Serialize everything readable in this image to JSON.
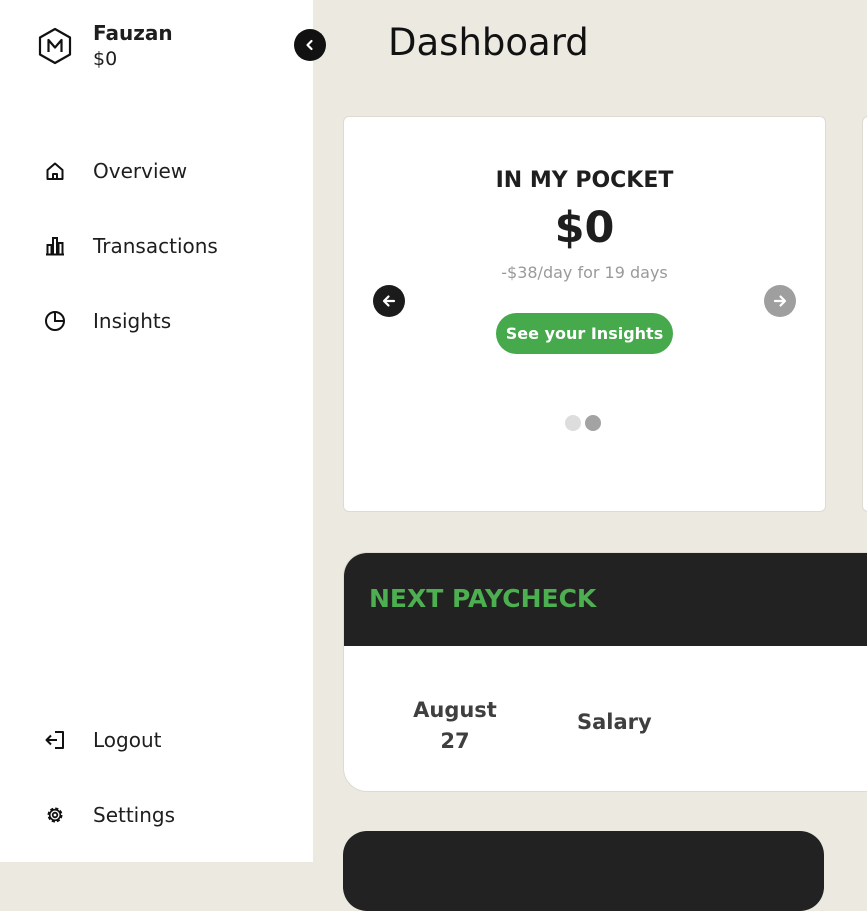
{
  "sidebar": {
    "logo_icon": "hexagon-m-logo-icon",
    "profile": {
      "name": "Fauzan",
      "balance": "$0"
    },
    "collapse_icon": "chevron-left-icon",
    "nav": [
      {
        "label": "Overview",
        "icon": "home-icon"
      },
      {
        "label": "Transactions",
        "icon": "bar-chart-icon"
      },
      {
        "label": "Insights",
        "icon": "pie-chart-icon"
      }
    ],
    "footer": [
      {
        "label": "Logout",
        "icon": "logout-icon"
      },
      {
        "label": "Settings",
        "icon": "gear-icon"
      }
    ]
  },
  "header": {
    "title": "Dashboard"
  },
  "pocket_card": {
    "title": "IN MY POCKET",
    "amount": "$0",
    "subtitle": "-$38/day for 19 days",
    "button_label": "See your Insights",
    "prev_icon": "arrow-left-icon",
    "next_icon": "arrow-right-icon",
    "slide_count": 2,
    "active_slide": 2
  },
  "paycheck_card": {
    "title": "NEXT PAYCHECK",
    "date": "August 27",
    "description": "Salary"
  },
  "colors": {
    "accent_green": "#46a94b",
    "paycheck_title_green": "#4caf50",
    "dark": "#222222",
    "page_background": "#ece9e1"
  }
}
